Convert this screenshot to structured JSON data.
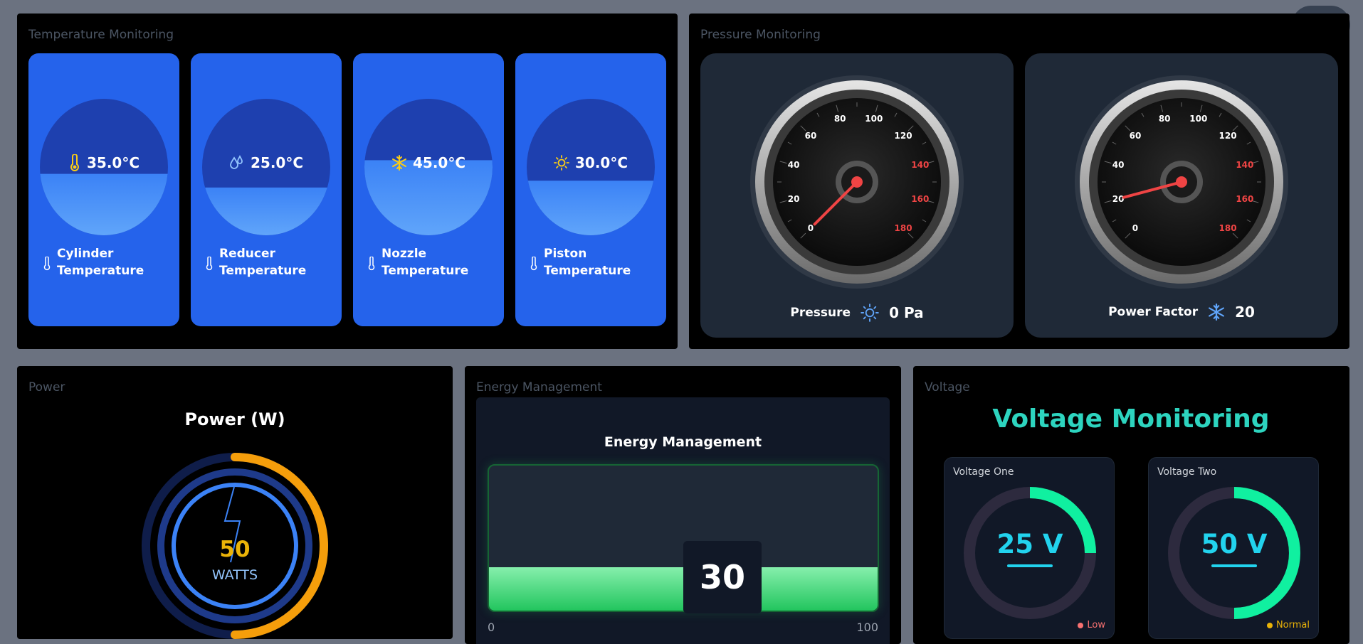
{
  "temperature": {
    "title": "Temperature Monitoring",
    "cards": [
      {
        "value": "35.0°C",
        "label": "Cylinder Temperature",
        "icon": "thermometer-icon",
        "fill_percent": 35,
        "icon_color": "#facc15"
      },
      {
        "value": "25.0°C",
        "label": "Reducer Temperature",
        "icon": "droplets-icon",
        "fill_percent": 25,
        "icon_color": "#93c5fd"
      },
      {
        "value": "45.0°C",
        "label": "Nozzle Temperature",
        "icon": "snowflake-icon",
        "fill_percent": 45,
        "icon_color": "#facc15"
      },
      {
        "value": "30.0°C",
        "label": "Piston Temperature",
        "icon": "sun-icon",
        "fill_percent": 30,
        "icon_color": "#facc15"
      }
    ]
  },
  "pressure": {
    "title": "Pressure Monitoring",
    "gauges": [
      {
        "label": "Pressure",
        "value": "0 Pa",
        "icon": "sun-icon",
        "reading": 0,
        "ticks": [
          "0",
          "20",
          "40",
          "60",
          "80",
          "100",
          "120",
          "140",
          "160",
          "180"
        ]
      },
      {
        "label": "Power Factor",
        "value": "20",
        "icon": "snowflake-icon",
        "reading": 20,
        "ticks": [
          "0",
          "20",
          "40",
          "60",
          "80",
          "100",
          "120",
          "140",
          "160",
          "180"
        ]
      }
    ]
  },
  "power": {
    "title": "Power",
    "heading": "Power (W)",
    "value": "50",
    "unit": "WATTS",
    "ring_percent": 50
  },
  "energy": {
    "title": "Energy Management",
    "heading": "Energy Management",
    "value": "30",
    "min": "0",
    "max": "100",
    "fill_percent": 30
  },
  "voltage": {
    "title": "Voltage",
    "heading": "Voltage Monitoring",
    "cards": [
      {
        "label": "Voltage One",
        "value": "25 V",
        "status": "Low",
        "status_color": "#f87171",
        "fill_percent": 25
      },
      {
        "label": "Voltage Two",
        "value": "50 V",
        "status": "Normal",
        "status_color": "#eab308",
        "fill_percent": 50
      }
    ]
  },
  "colors": {
    "accent_blue": "#2563eb",
    "gauge_red": "#ef4444",
    "power_orange": "#f59e0b",
    "energy_green": "#22c55e",
    "voltage_green": "#10f0a0",
    "voltage_teal": "#2dd4bf"
  }
}
